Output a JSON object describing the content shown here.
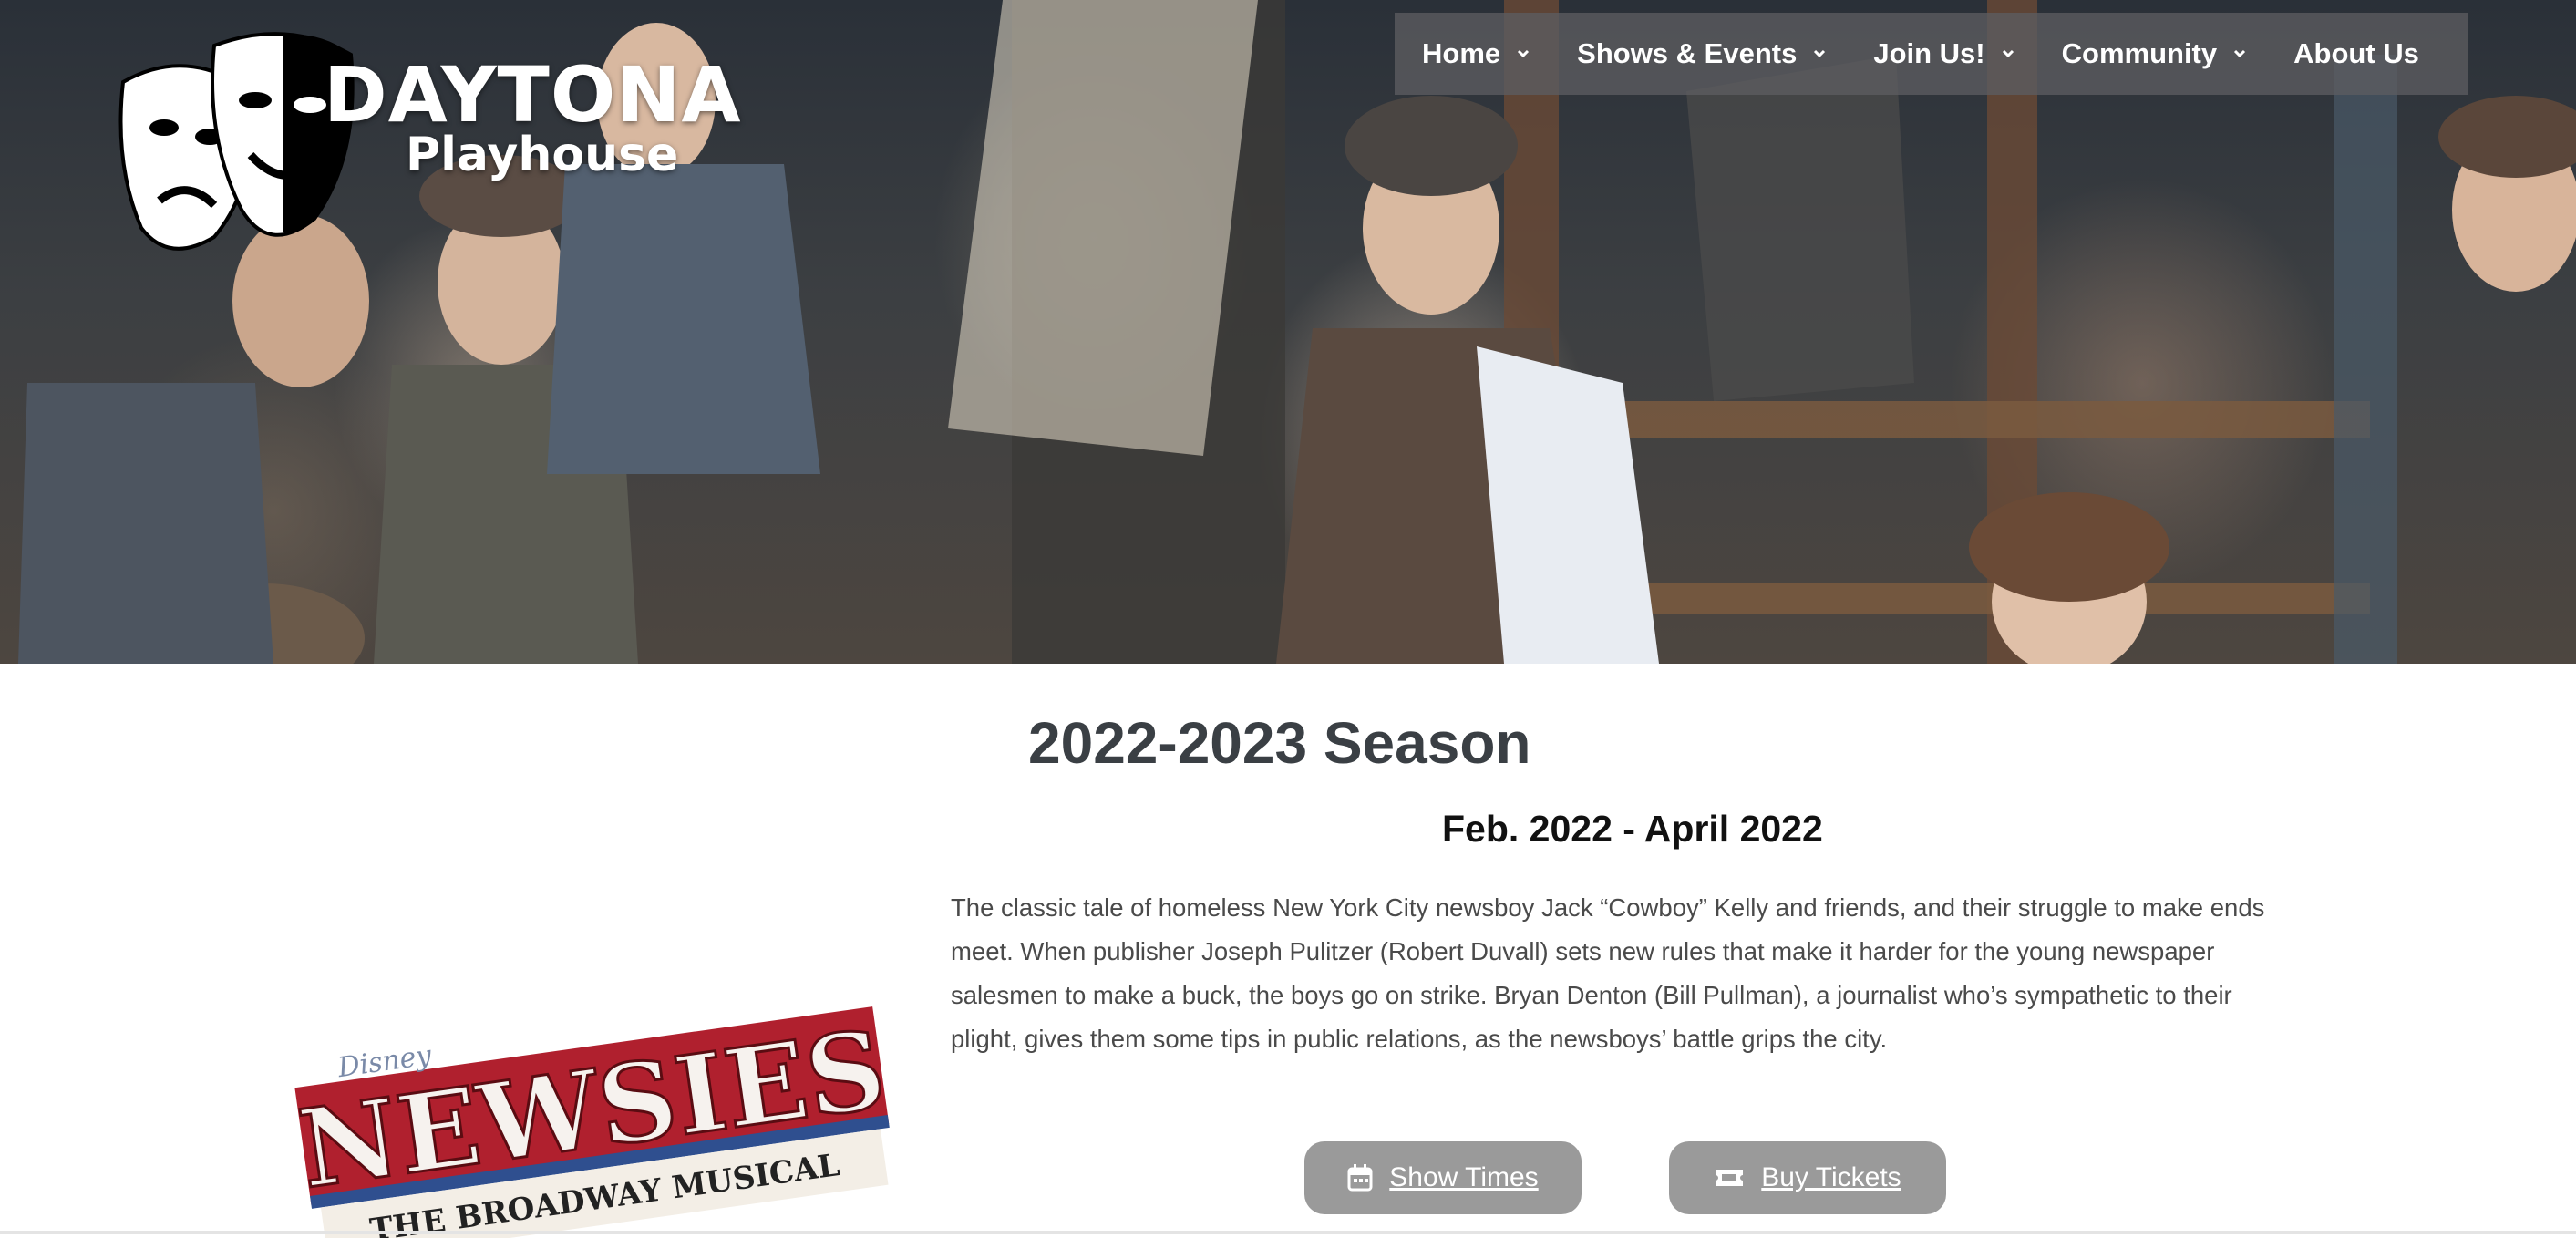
{
  "brand": {
    "name_line1": "DAYTONA",
    "name_line2": "Playhouse"
  },
  "nav": {
    "items": [
      {
        "label": "Home",
        "has_dropdown": true
      },
      {
        "label": "Shows & Events",
        "has_dropdown": true
      },
      {
        "label": "Join Us!",
        "has_dropdown": true
      },
      {
        "label": "Community",
        "has_dropdown": true
      },
      {
        "label": "About Us",
        "has_dropdown": false
      }
    ]
  },
  "season": {
    "title": "2022-2023 Season",
    "dates": "Feb. 2022 - April 2022",
    "description": "The classic tale of homeless New York City newsboy Jack “Cowboy” Kelly and friends, and their struggle to make ends meet.  When publisher Joseph Pulitzer (Robert Duvall) sets new rules that make it harder for the young newspaper salesmen to make a buck, the boys go on strike. Bryan Denton (Bill Pullman), a journalist who’s sympathetic to their plight, gives them some tips in public relations, as the newsboys’ battle grips the city."
  },
  "show_logo": {
    "title": "NEWSIES",
    "subtitle": "THE BROADWAY MUSICAL",
    "brand_mark": "Disney"
  },
  "buttons": {
    "show_times": {
      "label": "Show Times",
      "icon": "calendar-icon"
    },
    "buy_tickets": {
      "label": "Buy Tickets",
      "icon": "ticket-icon"
    }
  },
  "colors": {
    "nav_bg": "#5c5c60",
    "button_bg": "#9a9a9a",
    "title_color": "#3a3f44",
    "newsies_red": "#b0202e"
  }
}
